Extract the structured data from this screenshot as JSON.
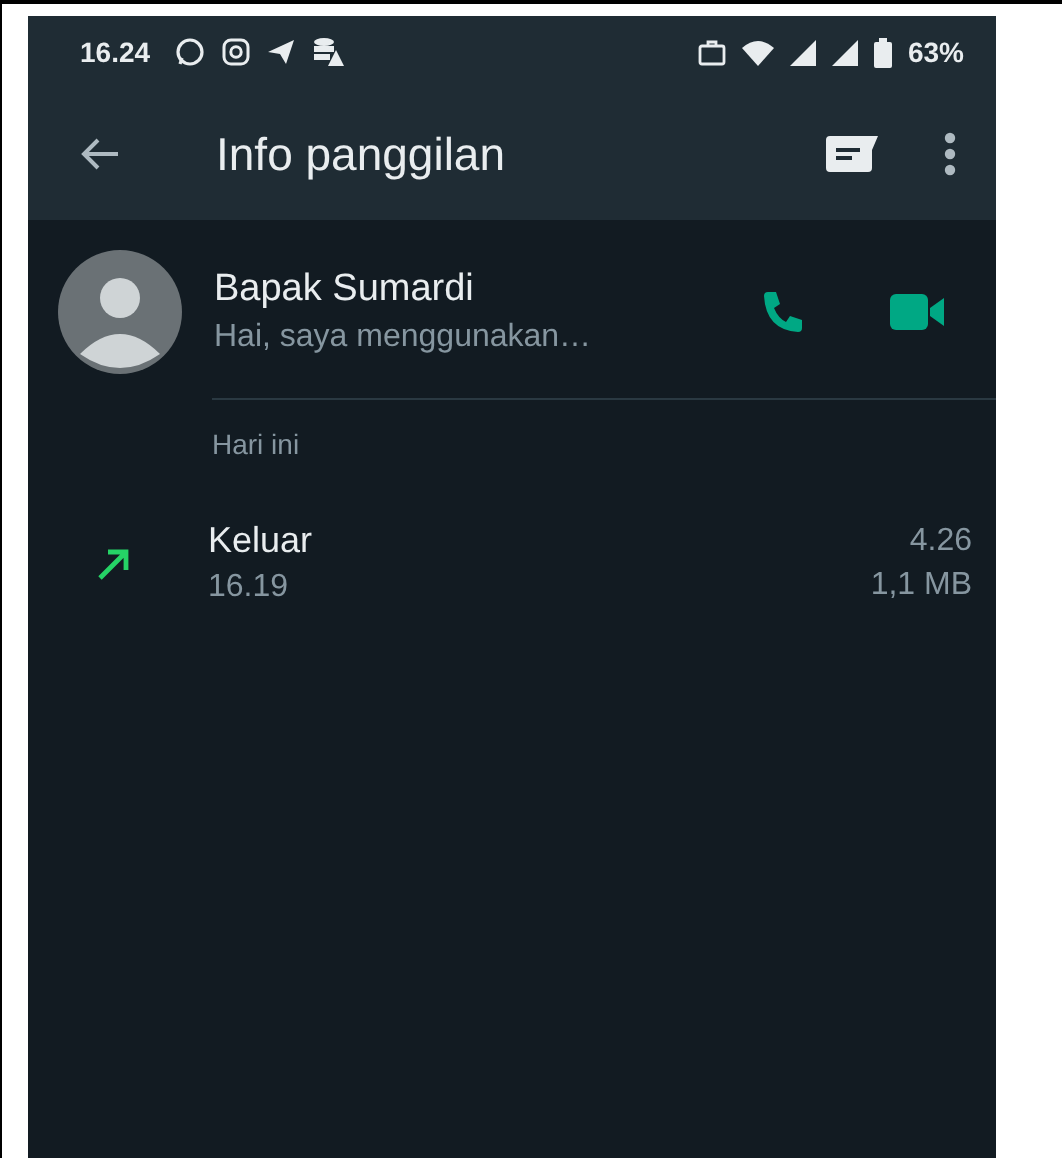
{
  "status_bar": {
    "time": "16.24",
    "battery": "63%"
  },
  "toolbar": {
    "title": "Info panggilan"
  },
  "contact": {
    "name": "Bapak Sumardi",
    "about": "Hai, saya menggunakan…"
  },
  "section": {
    "label": "Hari ini"
  },
  "calls": [
    {
      "kind": "outgoing",
      "label": "Keluar",
      "time": "16.19",
      "duration": "4.26",
      "size": "1,1 MB"
    }
  ]
}
